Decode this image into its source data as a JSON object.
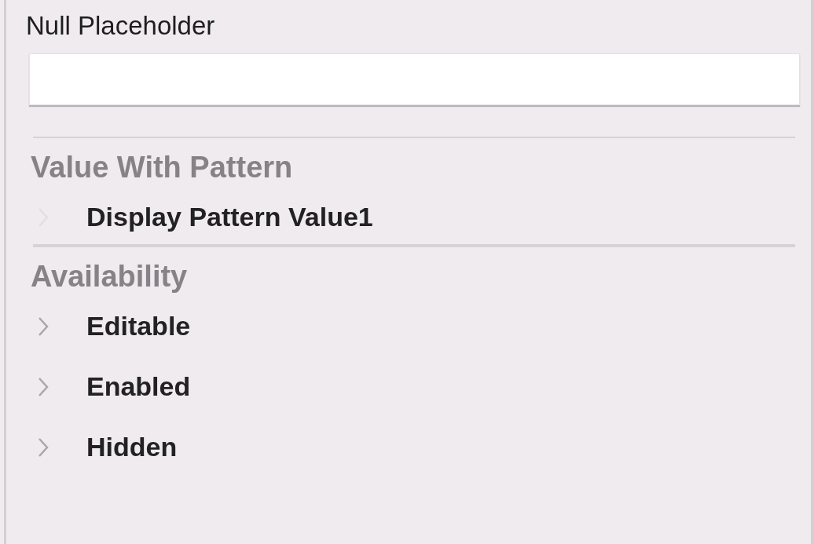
{
  "field": {
    "label": "Null Placeholder"
  },
  "sections": [
    {
      "title": "Value With Pattern",
      "rows": [
        {
          "label": "Display Pattern Value1",
          "disabled": true
        }
      ]
    },
    {
      "title": "Availability",
      "rows": [
        {
          "label": "Editable",
          "disabled": false
        },
        {
          "label": "Enabled",
          "disabled": false
        },
        {
          "label": "Hidden",
          "disabled": false
        }
      ]
    }
  ]
}
